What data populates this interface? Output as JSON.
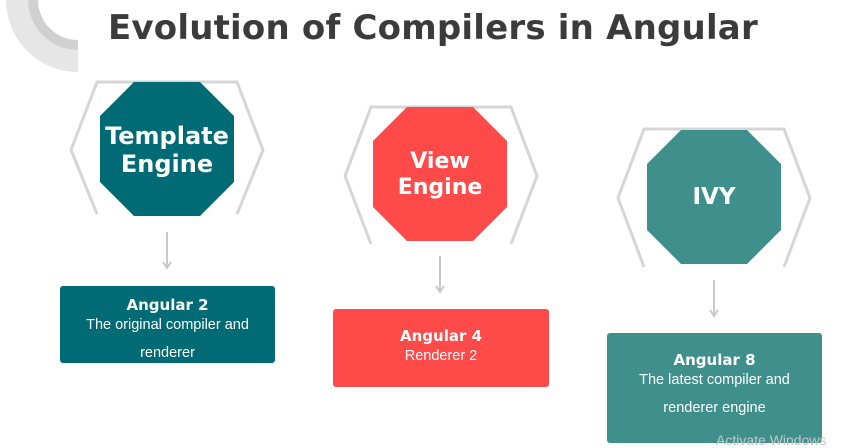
{
  "title": "Evolution of Compilers in Angular",
  "colors": {
    "title": "#3b3b3b",
    "outline": "#d6d6d6",
    "template_engine": "#006a75",
    "view_engine": "#ff4a4a",
    "ivy": "#3f908c",
    "arrow": "#c9c9c9"
  },
  "stages": [
    {
      "engine": "Template\nEngine",
      "card_title": "Angular 2",
      "card_desc": "The original compiler and\nrenderer"
    },
    {
      "engine": "View\nEngine",
      "card_title": "Angular 4",
      "card_desc": "Renderer 2"
    },
    {
      "engine": "IVY",
      "card_title": "Angular 8",
      "card_desc": "The latest compiler and\nrenderer engine"
    }
  ],
  "watermark": "Activate Windows"
}
